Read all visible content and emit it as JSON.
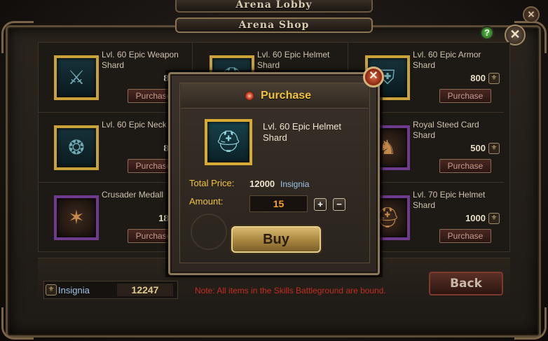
{
  "titles": {
    "lobby": "Arena Lobby",
    "shop": "Arena Shop"
  },
  "help_label": "?",
  "close_label": "✕",
  "items": [
    {
      "name": "Lvl. 60 Epic Weapon Shard",
      "price": "80",
      "purchase": "Purchase",
      "glyph": "⚔"
    },
    {
      "name": "Lvl. 60 Epic Helmet Shard",
      "price": "",
      "purchase": "",
      "glyph": "⛑"
    },
    {
      "name": "Lvl. 60 Epic Armor Shard",
      "price": "800",
      "purchase": "Purchase",
      "glyph": "⛨"
    },
    {
      "name": "Lvl. 60 Epic Neck",
      "price": "80",
      "purchase": "Purchase",
      "glyph": "❂"
    },
    {
      "name": "",
      "price": "",
      "purchase": "",
      "glyph": ""
    },
    {
      "name": "Royal Steed Card Shard",
      "price": "500",
      "purchase": "Purchase",
      "glyph": "♞"
    },
    {
      "name": "Crusader Medall",
      "price": "180",
      "purchase": "Purchase",
      "glyph": "✶"
    },
    {
      "name": "",
      "price": "",
      "purchase": "",
      "glyph": ""
    },
    {
      "name": "Lvl. 70 Epic Helmet Shard",
      "price": "1000",
      "purchase": "Purchase",
      "glyph": "⛑"
    }
  ],
  "coin_glyph": "⚜",
  "footer": {
    "insignia_label": "Insignia",
    "insignia_value": "12247",
    "note": "Note: All items in the Skills Battleground are bound.",
    "back_label": "Back"
  },
  "modal": {
    "title": "Purchase",
    "item_name": "Lvl. 60 Epic Helmet Shard",
    "item_glyph": "⛑",
    "total_price_label": "Total Price:",
    "total_price_value": "12000",
    "total_price_unit": "Insignia",
    "amount_label": "Amount:",
    "amount_value": "15",
    "plus_label": "+",
    "minus_label": "−",
    "buy_label": "Buy"
  }
}
